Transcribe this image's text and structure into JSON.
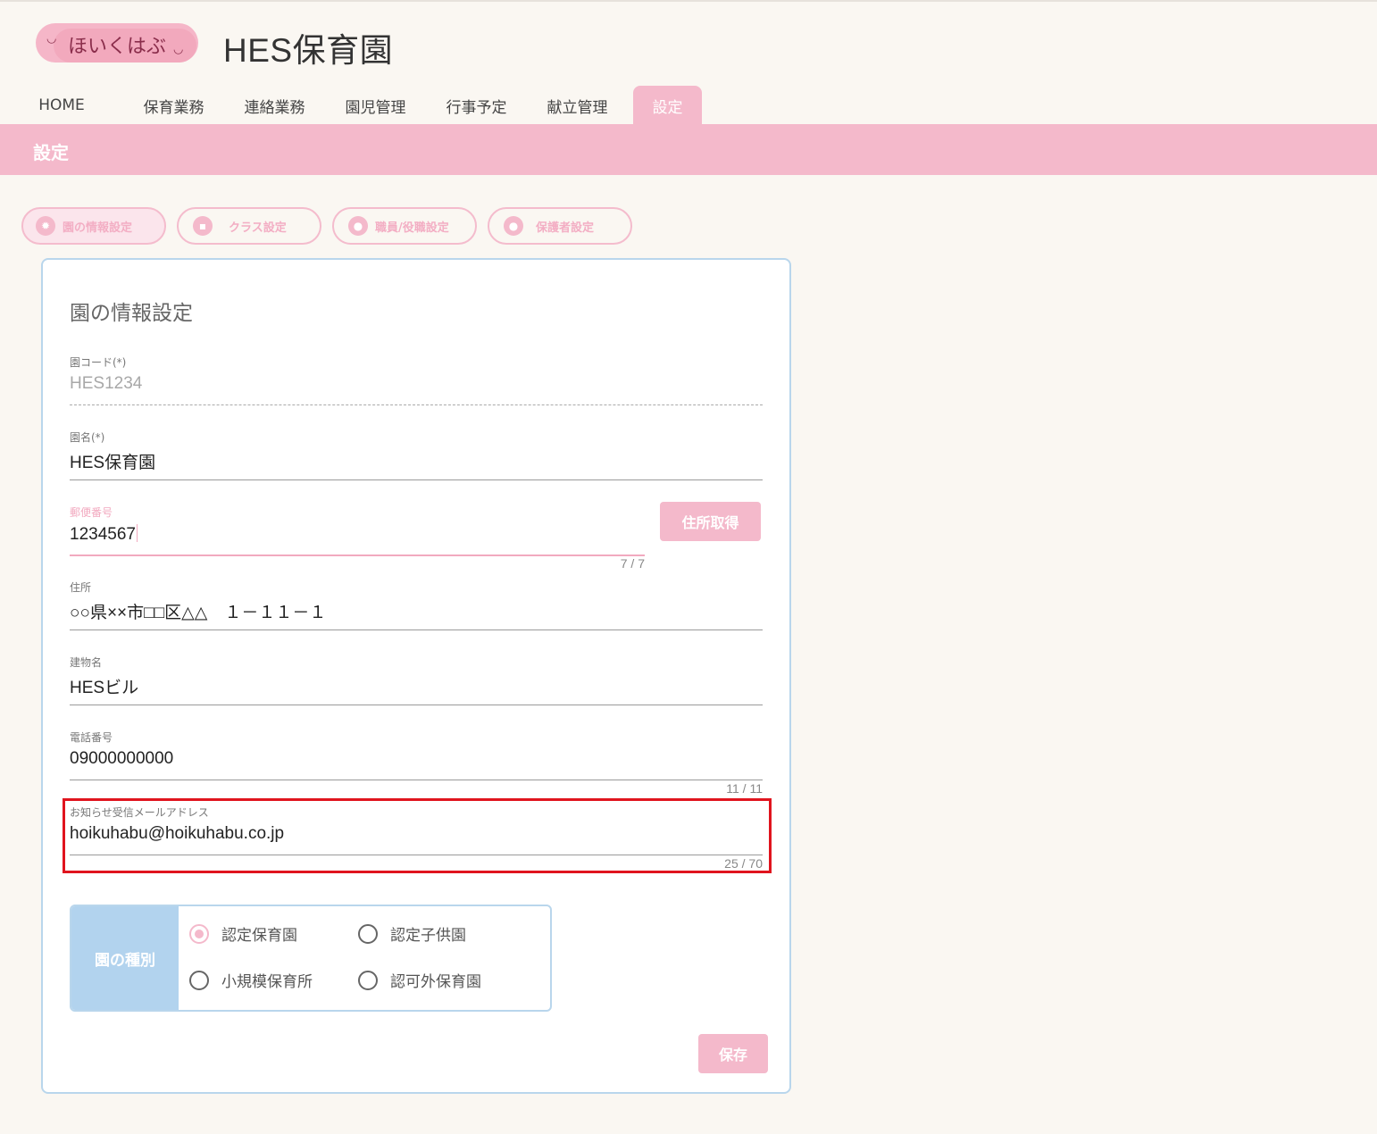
{
  "header": {
    "logo_text": "ほいくはぶ",
    "site_title": "HES保育園"
  },
  "nav": {
    "items": [
      {
        "label": "HOME"
      },
      {
        "label": "保育業務"
      },
      {
        "label": "連絡業務"
      },
      {
        "label": "園児管理"
      },
      {
        "label": "行事予定"
      },
      {
        "label": "献立管理"
      },
      {
        "label": "設定",
        "active": true
      }
    ]
  },
  "page": {
    "title": "設定"
  },
  "subtabs": [
    {
      "label": "園の情報設定",
      "icon": "gear-icon",
      "active": true
    },
    {
      "label": "クラス設定",
      "icon": "teacher-icon"
    },
    {
      "label": "職員/役職設定",
      "icon": "staff-icon"
    },
    {
      "label": "保護者設定",
      "icon": "guardian-icon"
    }
  ],
  "form": {
    "title": "園の情報設定",
    "code": {
      "label": "園コード(*)",
      "value": "HES1234"
    },
    "name": {
      "label": "園名(*)",
      "value": "HES保育園"
    },
    "postal": {
      "label": "郵便番号",
      "value": "1234567",
      "counter": "7 / 7"
    },
    "address_button": "住所取得",
    "address": {
      "label": "住所",
      "value": "○○県××市□□区△△　１－１１－１"
    },
    "building": {
      "label": "建物名",
      "value": "HESビル"
    },
    "phone": {
      "label": "電話番号",
      "value": "09000000000",
      "counter": "11 / 11"
    },
    "email": {
      "label": "お知らせ受信メールアドレス",
      "value": "hoikuhabu@hoikuhabu.co.jp",
      "counter": "25 / 70"
    },
    "type": {
      "label": "園の種別",
      "options": [
        {
          "label": "認定保育園",
          "checked": true
        },
        {
          "label": "認定子供園"
        },
        {
          "label": "小規模保育所"
        },
        {
          "label": "認可外保育園"
        }
      ]
    },
    "save_button": "保存"
  },
  "colors": {
    "accent_pink": "#f4b9cb",
    "accent_blue": "#b2d3ee",
    "highlight_red": "#e0141e"
  }
}
